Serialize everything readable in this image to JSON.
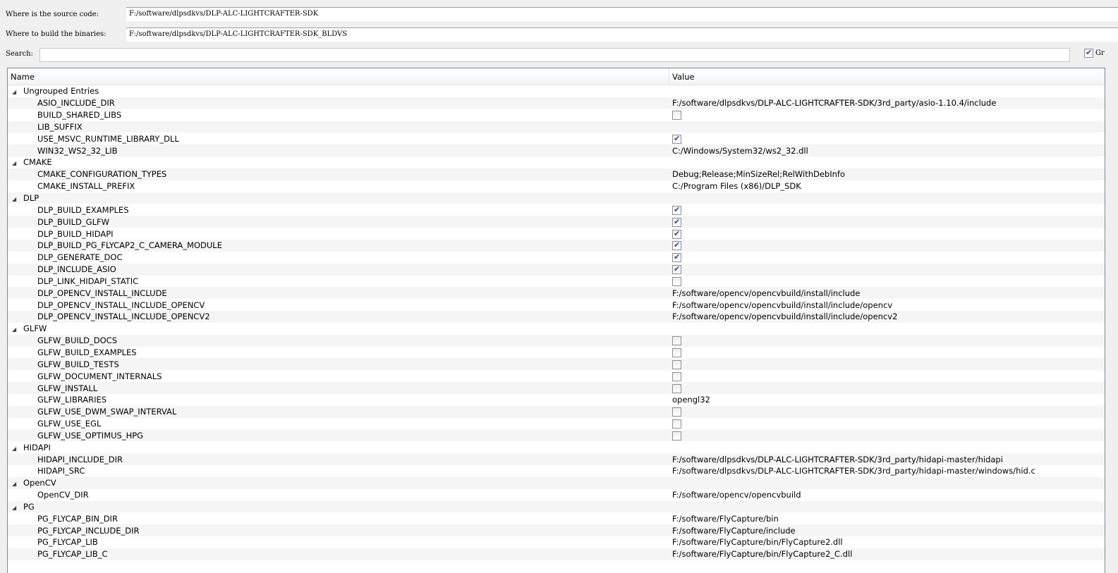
{
  "source_label": "Where is the source code:",
  "source_value": "F:/software/dlpsdkvs/DLP-ALC-LIGHTCRAFTER-SDK",
  "build_label": "Where to build the binaries:",
  "build_value": "F:/software/dlpsdkvs/DLP-ALC-LIGHTCRAFTER-SDK_BLDVS",
  "search_label": "Search:",
  "search_value": "",
  "grouped_label": "Gr",
  "grouped_checked": true,
  "columns": {
    "name": "Name",
    "value": "Value"
  },
  "groups": [
    {
      "name": "Ungrouped Entries",
      "entries": [
        {
          "name": "ASIO_INCLUDE_DIR",
          "value": "F:/software/dlpsdkvs/DLP-ALC-LIGHTCRAFTER-SDK/3rd_party/asio-1.10.4/include"
        },
        {
          "name": "BUILD_SHARED_LIBS",
          "bool": false
        },
        {
          "name": "LIB_SUFFIX",
          "value": ""
        },
        {
          "name": "USE_MSVC_RUNTIME_LIBRARY_DLL",
          "bool": true
        },
        {
          "name": "WIN32_WS2_32_LIB",
          "value": "C:/Windows/System32/ws2_32.dll"
        }
      ]
    },
    {
      "name": "CMAKE",
      "entries": [
        {
          "name": "CMAKE_CONFIGURATION_TYPES",
          "value": "Debug;Release;MinSizeRel;RelWithDebInfo"
        },
        {
          "name": "CMAKE_INSTALL_PREFIX",
          "value": "C:/Program Files (x86)/DLP_SDK"
        }
      ]
    },
    {
      "name": "DLP",
      "entries": [
        {
          "name": "DLP_BUILD_EXAMPLES",
          "bool": true
        },
        {
          "name": "DLP_BUILD_GLFW",
          "bool": true
        },
        {
          "name": "DLP_BUILD_HIDAPI",
          "bool": true
        },
        {
          "name": "DLP_BUILD_PG_FLYCAP2_C_CAMERA_MODULE",
          "bool": true
        },
        {
          "name": "DLP_GENERATE_DOC",
          "bool": true
        },
        {
          "name": "DLP_INCLUDE_ASIO",
          "bool": true
        },
        {
          "name": "DLP_LINK_HIDAPI_STATIC",
          "bool": false
        },
        {
          "name": "DLP_OPENCV_INSTALL_INCLUDE",
          "value": "F:/software/opencv/opencvbuild/install/include"
        },
        {
          "name": "DLP_OPENCV_INSTALL_INCLUDE_OPENCV",
          "value": "F:/software/opencv/opencvbuild/install/include/opencv"
        },
        {
          "name": "DLP_OPENCV_INSTALL_INCLUDE_OPENCV2",
          "value": "F:/software/opencv/opencvbuild/install/include/opencv2"
        }
      ]
    },
    {
      "name": "GLFW",
      "entries": [
        {
          "name": "GLFW_BUILD_DOCS",
          "bool": false
        },
        {
          "name": "GLFW_BUILD_EXAMPLES",
          "bool": false
        },
        {
          "name": "GLFW_BUILD_TESTS",
          "bool": false
        },
        {
          "name": "GLFW_DOCUMENT_INTERNALS",
          "bool": false
        },
        {
          "name": "GLFW_INSTALL",
          "bool": false
        },
        {
          "name": "GLFW_LIBRARIES",
          "value": "opengl32"
        },
        {
          "name": "GLFW_USE_DWM_SWAP_INTERVAL",
          "bool": false
        },
        {
          "name": "GLFW_USE_EGL",
          "bool": false
        },
        {
          "name": "GLFW_USE_OPTIMUS_HPG",
          "bool": false
        }
      ]
    },
    {
      "name": "HIDAPI",
      "entries": [
        {
          "name": "HIDAPI_INCLUDE_DIR",
          "value": "F:/software/dlpsdkvs/DLP-ALC-LIGHTCRAFTER-SDK/3rd_party/hidapi-master/hidapi"
        },
        {
          "name": "HIDAPI_SRC",
          "value": "F:/software/dlpsdkvs/DLP-ALC-LIGHTCRAFTER-SDK/3rd_party/hidapi-master/windows/hid.c"
        }
      ]
    },
    {
      "name": "OpenCV",
      "entries": [
        {
          "name": "OpenCV_DIR",
          "value": "F:/software/opencv/opencvbuild"
        }
      ]
    },
    {
      "name": "PG",
      "entries": [
        {
          "name": "PG_FLYCAP_BIN_DIR",
          "value": "F:/software/FlyCapture/bin"
        },
        {
          "name": "PG_FLYCAP_INCLUDE_DIR",
          "value": "F:/software/FlyCapture/include"
        },
        {
          "name": "PG_FLYCAP_LIB",
          "value": "F:/software/FlyCapture/bin/FlyCapture2.dll"
        },
        {
          "name": "PG_FLYCAP_LIB_C",
          "value": "F:/software/FlyCapture/bin/FlyCapture2_C.dll"
        }
      ]
    }
  ]
}
